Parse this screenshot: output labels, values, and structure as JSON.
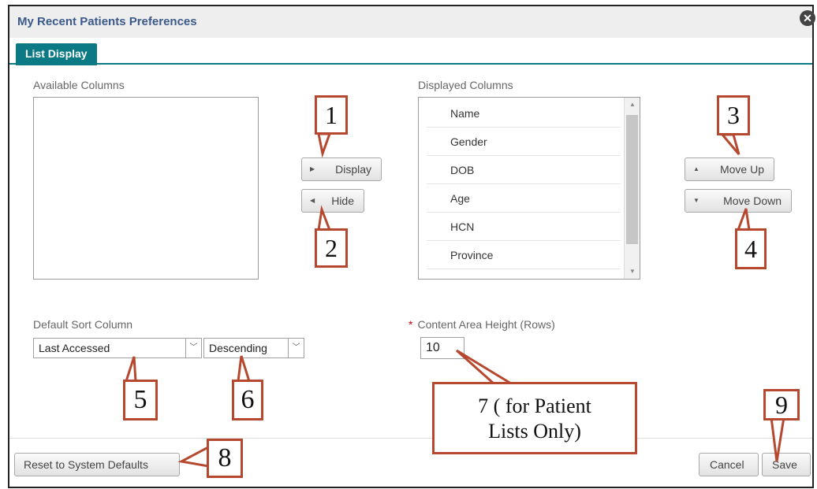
{
  "dialog": {
    "title": "My Recent Patients Preferences",
    "close_icon": "close-icon",
    "tab_label": "List Display"
  },
  "available": {
    "label": "Available Columns",
    "items": []
  },
  "displayed": {
    "label": "Displayed Columns",
    "items": [
      "Name",
      "Gender",
      "DOB",
      "Age",
      "HCN",
      "Province"
    ]
  },
  "buttons": {
    "display": "Display",
    "hide": "Hide",
    "move_up": "Move Up",
    "move_down": "Move Down",
    "reset": "Reset to System Defaults",
    "cancel": "Cancel",
    "save": "Save"
  },
  "sort": {
    "label": "Default Sort Column",
    "column_value": "Last Accessed",
    "order_value": "Descending"
  },
  "content_height": {
    "label": "Content Area Height (Rows)",
    "required_mark": "*",
    "value": "10"
  },
  "callouts": {
    "c1": "1",
    "c2": "2",
    "c3": "3",
    "c4": "4",
    "c5": "5",
    "c6": "6",
    "c7_line1": "7 ( for Patient",
    "c7_line2": "Lists Only)",
    "c8": "8",
    "c9": "9"
  },
  "colors": {
    "tab_accent": "#0c7a84",
    "title_text": "#3b5a8a",
    "callout_border": "#b5482f"
  }
}
